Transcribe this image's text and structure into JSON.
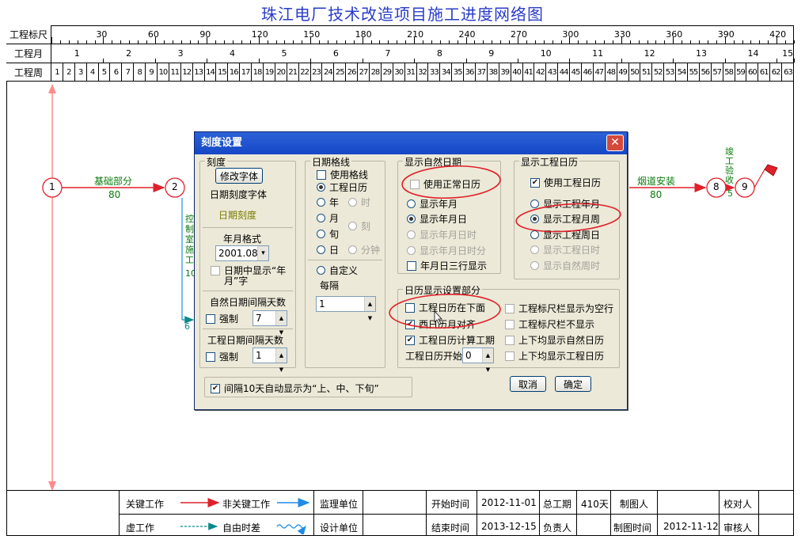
{
  "title": "珠江电厂技术改造项目施工进度网络图",
  "ruler": {
    "scale_label": "工程标尺",
    "month_label": "工程月",
    "week_label": "工程周",
    "scale_ticks": [
      "30",
      "60",
      "90",
      "120",
      "150",
      "180",
      "210",
      "240",
      "270",
      "300",
      "330",
      "360",
      "390",
      "420"
    ],
    "months": [
      "1",
      "2",
      "3",
      "4",
      "5",
      "6",
      "7",
      "8",
      "9",
      "10",
      "11",
      "12",
      "13",
      "14",
      "15"
    ],
    "weeks": [
      "1",
      "2",
      "3",
      "4",
      "5",
      "6",
      "7",
      "8",
      "9",
      "10",
      "11",
      "12",
      "13",
      "14",
      "15",
      "16",
      "17",
      "18",
      "19",
      "20",
      "21",
      "22",
      "23",
      "24",
      "25",
      "26",
      "27",
      "28",
      "29",
      "30",
      "31",
      "32",
      "33",
      "34",
      "35",
      "36",
      "37",
      "38",
      "39",
      "40",
      "41",
      "42",
      "43",
      "44",
      "45",
      "46",
      "47",
      "48",
      "49",
      "50",
      "51",
      "52",
      "53",
      "54",
      "55",
      "56",
      "57",
      "58",
      "59",
      "60",
      "61",
      "62",
      "63"
    ]
  },
  "network": {
    "nodes": [
      "1",
      "2",
      "8",
      "9"
    ],
    "task_1_2": {
      "name": "基础部分",
      "duration": "80"
    },
    "task_8_9": {
      "name": "烟道安装",
      "duration": "80"
    },
    "task_v": {
      "name": "控制室施工",
      "duration": "10"
    },
    "float_label": "6",
    "finish": {
      "name": "竣工验收",
      "duration": "5"
    },
    "colors": {
      "critical": "#e0202a",
      "noncritical": "#1e8ce8",
      "float": "#0a8a8a",
      "node": "#e0202a",
      "vertical": "#ff8a8a"
    }
  },
  "dialog": {
    "title": "刻度设置",
    "close_icon": "close-icon",
    "scale_group": {
      "label": "刻度",
      "modify_font_button": "修改字体",
      "date_scale_font_label": "日期刻度字体",
      "date_scale_sample": "日期刻度",
      "year_month_format_label": "年月格式",
      "year_month_format_value": "2001.08",
      "show_year_month_in_date": "日期中显示“年月”字",
      "natural_interval_label": "自然日期间隔天数",
      "natural_force": "强制",
      "natural_interval_value": "7",
      "project_interval_label": "工程日期间隔天数",
      "project_force": "强制",
      "project_interval_value": "1"
    },
    "gridline_group": {
      "label": "日期格线",
      "use_gridline": "使用格线",
      "project_calendar": "工程日历",
      "year": "年",
      "hour": "时",
      "month": "月",
      "quarter": "刻",
      "xun": "旬",
      "day": "日",
      "minute": "分钟",
      "custom": "自定义",
      "every": "每隔",
      "every_value": "1"
    },
    "natural_date_group": {
      "label": "显示自然日期",
      "use_normal_calendar": "使用正常日历",
      "show_year_month": "显示年月",
      "show_year_month_day": "显示年月日",
      "show_ymd_hour": "显示年月日时",
      "show_ymd_hour_min": "显示年月日时分",
      "ymd_three_rows": "年月日三行显示"
    },
    "project_calendar_group": {
      "label": "显示工程日历",
      "use_project_calendar": "使用工程日历",
      "show_project_year_month": "显示工程年月",
      "show_project_month_week": "显示工程月周",
      "show_project_week_day": "显示工程周日",
      "show_project_day_hour": "显示工程日时",
      "show_natural_week_hour": "显示自然周时"
    },
    "calendar_display_group": {
      "label": "日历显示设置部分",
      "project_calendar_below": "工程日历在下面",
      "gregorian_lunar_align": "西日历月对齐",
      "project_calendar_calc": "工程日历计算工期",
      "project_calendar_start": "工程日历开始",
      "project_calendar_start_value": "0",
      "ruler_blank_row": "工程标尺栏显示为空行",
      "ruler_hidden": "工程标尺栏不显示",
      "both_natural": "上下均显示自然日历",
      "both_project": "上下均显示工程日历"
    },
    "auto_xun": "间隔10天自动显示为“上、中、下旬”",
    "cancel_button": "取消",
    "ok_button": "确定"
  },
  "legend": {
    "critical_work": "关键工作",
    "noncritical_work": "非关键工作",
    "dummy_work": "虚工作",
    "free_float": "自由时差",
    "supervision_unit": "监理单位",
    "design_unit": "设计单位",
    "start_time_label": "开始时间",
    "start_time": "2012-11-01",
    "end_time_label": "结束时间",
    "end_time": "2013-12-15",
    "total_duration_label": "总工期",
    "total_duration": "410天",
    "responsible_label": "负责人",
    "drawer_label": "制图人",
    "draw_time_label": "制图时间",
    "draw_time": "2012-11-12",
    "proofreader_label": "校对人",
    "reviewer_label": "审核人"
  }
}
